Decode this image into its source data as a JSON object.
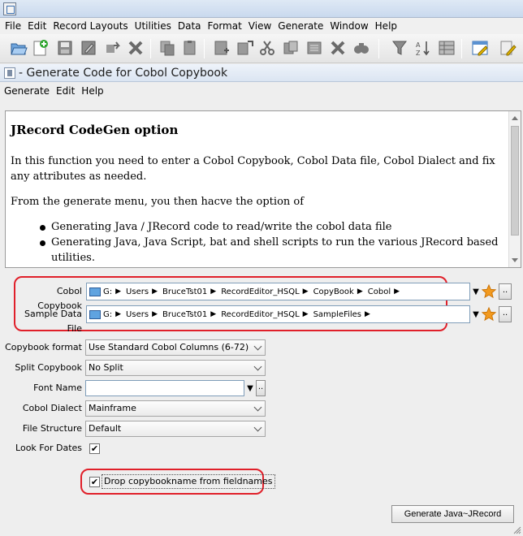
{
  "menubar": [
    "File",
    "Edit",
    "Record Layouts",
    "Utilities",
    "Data",
    "Format",
    "View",
    "Generate",
    "Window",
    "Help"
  ],
  "frame": {
    "title": "- Generate Code for Cobol Copybook"
  },
  "submenu": [
    "Generate",
    "Edit",
    "Help"
  ],
  "doc": {
    "heading": "JRecord CodeGen option",
    "para1": "In this function you need to enter a Cobol Copybook, Cobol Data file, Cobol Dialect and fix any attributes as needed.",
    "para2": "From the generate menu, you then hacve the option of",
    "bullets": [
      "Generating Java / JRecord code to read/write the cobol data file",
      "Generating Java, Java Script, bat and shell scripts to run the various JRecord based utilities."
    ]
  },
  "copybook": {
    "label": "Cobol Copybook",
    "path": [
      "G:",
      "Users",
      "BruceTst01",
      "RecordEditor_HSQL",
      "CopyBook",
      "Cobol"
    ]
  },
  "sample": {
    "label": "Sample Data File",
    "path": [
      "G:",
      "Users",
      "BruceTst01",
      "RecordEditor_HSQL",
      "SampleFiles"
    ]
  },
  "fields": {
    "format_label": "Copybook format",
    "format_value": "Use Standard Cobol Columns (6-72)",
    "split_label": "Split Copybook",
    "split_value": "No Split",
    "font_label": "Font Name",
    "font_value": "",
    "dialect_label": "Cobol Dialect",
    "dialect_value": "Mainframe",
    "structure_label": "File Structure",
    "structure_value": "Default",
    "dates_label": "Look For Dates",
    "drop_label": "Drop copybookname from fieldnames"
  },
  "buttons": {
    "generate": "Generate Java~JRecord",
    "ellipsis": "..",
    "checkmark": "✔",
    "arrow": "▶",
    "dropdown": "▼"
  },
  "colors": {
    "highlight": "#e0202a",
    "star": "#f29a1f"
  }
}
